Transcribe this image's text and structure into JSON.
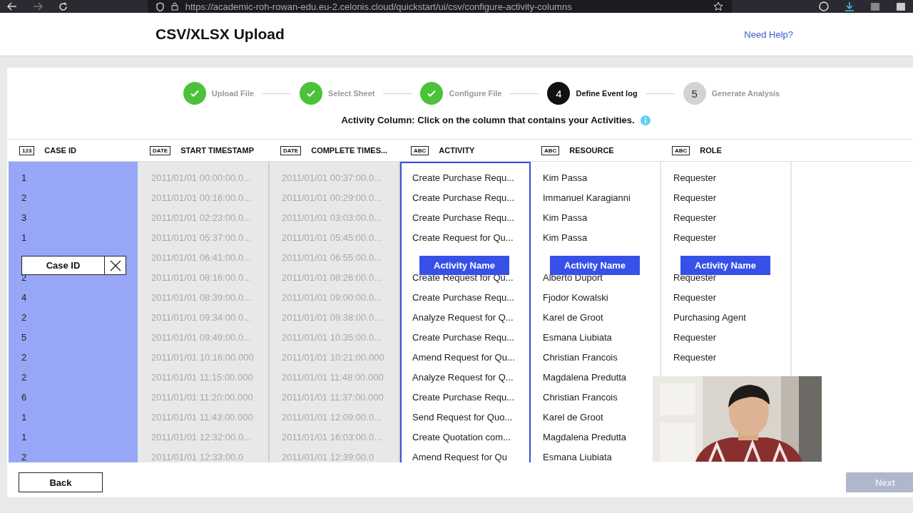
{
  "browser": {
    "url": "https://academic-roh-rowan-edu.eu-2.celonis.cloud/quickstart/ui/csv/configure-activity-columns"
  },
  "header": {
    "title": "CSV/XLSX Upload",
    "help_link": "Need Help?"
  },
  "steps": [
    {
      "label": "Upload File",
      "kind": "done"
    },
    {
      "label": "Select Sheet",
      "kind": "done"
    },
    {
      "label": "Configure File",
      "kind": "done"
    },
    {
      "label": "Define Event log",
      "kind": "current",
      "number": "4"
    },
    {
      "label": "Generate Analysis",
      "kind": "pending",
      "number": "5"
    }
  ],
  "instruction": "Activity Column: Click on the column that contains your Activities.",
  "columns": [
    {
      "type_badge": "123",
      "name": "CASE ID",
      "kind": "case",
      "selected": false,
      "tag": {
        "label": "Case ID",
        "kind": "assigned"
      }
    },
    {
      "type_badge": "DATE",
      "name": "START TIMESTAMP",
      "kind": "mapped",
      "selected": false
    },
    {
      "type_badge": "DATE",
      "name": "COMPLETE TIMES...",
      "kind": "mapped",
      "selected": false
    },
    {
      "type_badge": "ABC",
      "name": "ACTIVITY",
      "kind": "open",
      "selected": true,
      "tag": {
        "label": "Activity Name",
        "kind": "suggest"
      }
    },
    {
      "type_badge": "ABC",
      "name": "RESOURCE",
      "kind": "open",
      "selected": false,
      "tag": {
        "label": "Activity Name",
        "kind": "suggest"
      }
    },
    {
      "type_badge": "ABC",
      "name": "ROLE",
      "kind": "open",
      "selected": false,
      "tag": {
        "label": "Activity Name",
        "kind": "suggest"
      }
    }
  ],
  "rows": [
    [
      "1",
      "2011/01/01 00:00:00.0...",
      "2011/01/01 00:37:00.0...",
      "Create Purchase Requ...",
      "Kim Passa",
      "Requester"
    ],
    [
      "2",
      "2011/01/01 00:16:00.0...",
      "2011/01/01 00:29:00.0...",
      "Create Purchase Requ...",
      "Immanuel Karagianni",
      "Requester"
    ],
    [
      "3",
      "2011/01/01 02:23:00.0...",
      "2011/01/01 03:03:00.0...",
      "Create Purchase Requ...",
      "Kim Passa",
      "Requester"
    ],
    [
      "1",
      "2011/01/01 05:37:00.0...",
      "2011/01/01 05:45:00.0...",
      "Create Request for Qu...",
      "Kim Passa",
      "Requester"
    ],
    [
      null,
      "2011/01/01 06:41:00.0...",
      "2011/01/01 06:55:00.0...",
      null,
      null,
      null
    ],
    [
      "2",
      "2011/01/01 08:16:00.0...",
      "2011/01/01 08:26:00.0...",
      "Create Request for Qu...",
      "Alberto Duport",
      "Requester"
    ],
    [
      "4",
      "2011/01/01 08:39:00.0...",
      "2011/01/01 09:00:00.0...",
      "Create Purchase Requ...",
      "Fjodor Kowalski",
      "Requester"
    ],
    [
      "2",
      "2011/01/01 09:34:00.0...",
      "2011/01/01 09:38:00.0...",
      "Analyze Request for Q...",
      "Karel de Groot",
      "Purchasing Agent"
    ],
    [
      "5",
      "2011/01/01 09:49:00.0...",
      "2011/01/01 10:35:00.0...",
      "Create Purchase Requ...",
      "Esmana Liubiata",
      "Requester"
    ],
    [
      "2",
      "2011/01/01 10:16:00.000",
      "2011/01/01 10:21:00.000",
      "Amend Request for Qu...",
      "Christian Francois",
      "Requester"
    ],
    [
      "2",
      "2011/01/01 11:15:00.000",
      "2011/01/01 11:48:00.000",
      "Analyze Request for Q...",
      "Magdalena Predutta",
      null
    ],
    [
      "6",
      "2011/01/01 11:20:00.000",
      "2011/01/01 11:37:00.000",
      "Create Purchase Requ...",
      "Christian Francois",
      null
    ],
    [
      "1",
      "2011/01/01 11:43:00.000",
      "2011/01/01 12:09:00.0...",
      "Send Request for Quo...",
      "Karel de Groot",
      null
    ],
    [
      "1",
      "2011/01/01 12:32:00.0...",
      "2011/01/01 16:03:00.0...",
      "Create Quotation com...",
      "Magdalena Predutta",
      null
    ],
    [
      "2",
      "2011/01/01 12:33:00.0",
      "2011/01/01 12:39:00.0",
      "Amend Request for Qu",
      "Esmana Liubiata",
      null
    ]
  ],
  "footer": {
    "back": "Back",
    "next": {
      "label": "Next",
      "disabled": true
    }
  }
}
